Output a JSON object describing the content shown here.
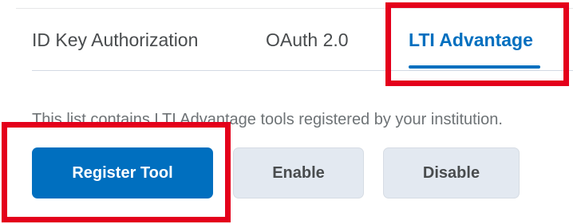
{
  "tabs": {
    "items": [
      {
        "label": "ID Key Authorization"
      },
      {
        "label": "OAuth 2.0"
      },
      {
        "label": "LTI Advantage"
      }
    ],
    "active_index": 2
  },
  "description": "This list contains LTI Advantage tools registered by your institution.",
  "buttons": {
    "register_label": "Register Tool",
    "enable_label": "Enable",
    "disable_label": "Disable"
  },
  "colors": {
    "accent": "#006fbf",
    "highlight": "#e4001b",
    "secondary_button": "#e3e9f1"
  }
}
